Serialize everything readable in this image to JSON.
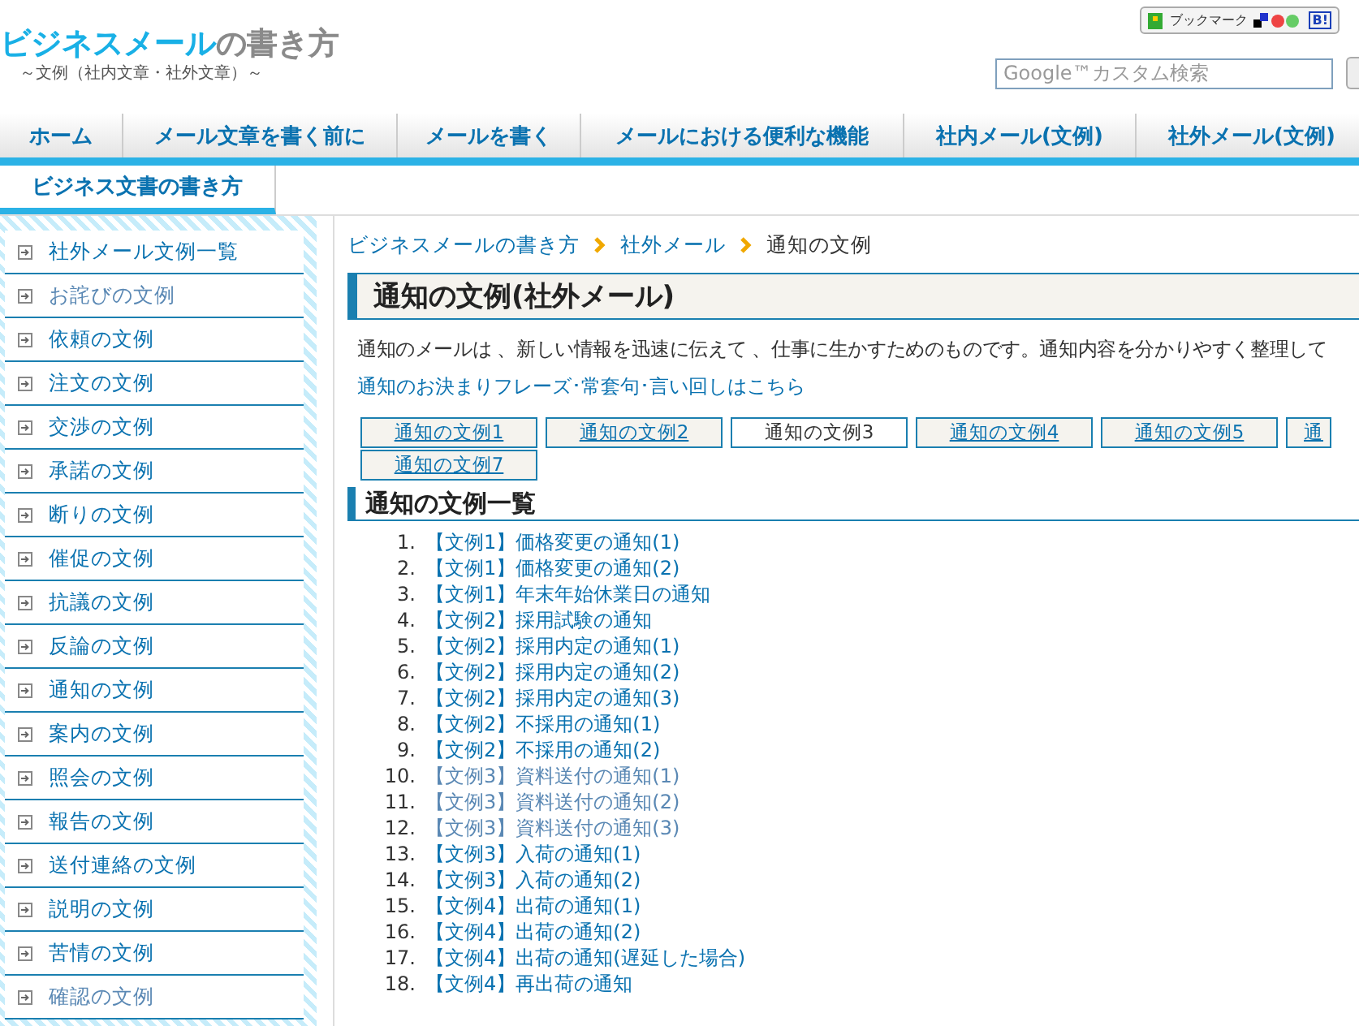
{
  "header": {
    "logo_main": "ビジネスメール",
    "logo_sub": "の書き方",
    "tagline": "～文例（社内文章・社外文章）～",
    "bookmark": {
      "label": "ブックマーク",
      "badge": "B!"
    },
    "search": {
      "placeholder": "Google™カスタム検索"
    }
  },
  "nav": [
    {
      "label": "ホーム"
    },
    {
      "label": "メール文章を書く前に"
    },
    {
      "label": "メールを書く"
    },
    {
      "label": "メールにおける便利な機能"
    },
    {
      "label": "社内メール(文例)"
    },
    {
      "label": "社外メール(文例)"
    }
  ],
  "subnav": {
    "label": "ビジネス文書の書き方"
  },
  "sidebar": {
    "items": [
      {
        "label": "社外メール文例一覧",
        "visited": false
      },
      {
        "label": "お詫びの文例",
        "visited": true
      },
      {
        "label": "依頼の文例",
        "visited": false
      },
      {
        "label": "注文の文例",
        "visited": false
      },
      {
        "label": "交渉の文例",
        "visited": false
      },
      {
        "label": "承諾の文例",
        "visited": false
      },
      {
        "label": "断りの文例",
        "visited": false
      },
      {
        "label": "催促の文例",
        "visited": false
      },
      {
        "label": "抗議の文例",
        "visited": false
      },
      {
        "label": "反論の文例",
        "visited": false
      },
      {
        "label": "通知の文例",
        "visited": false
      },
      {
        "label": "案内の文例",
        "visited": false
      },
      {
        "label": "照会の文例",
        "visited": false
      },
      {
        "label": "報告の文例",
        "visited": false
      },
      {
        "label": "送付連絡の文例",
        "visited": false
      },
      {
        "label": "説明の文例",
        "visited": false
      },
      {
        "label": "苦情の文例",
        "visited": false
      },
      {
        "label": "確認の文例",
        "visited": true
      }
    ]
  },
  "breadcrumb": [
    {
      "label": "ビジネスメールの書き方",
      "link": true
    },
    {
      "label": "社外メール",
      "link": true
    },
    {
      "label": "通知の文例",
      "link": false
    }
  ],
  "title": "通知の文例(社外メール)",
  "intro": "通知のメールは 、新しい情報を迅速に伝えて 、仕事に生かすためのものです。通知内容を分かりやすく整理して",
  "phrase_link": "通知のお決まりフレーズ･常套句･言い回しはこちら",
  "tabs": [
    {
      "label": "通知の文例1",
      "selected": false
    },
    {
      "label": "通知の文例2",
      "selected": false
    },
    {
      "label": "通知の文例3",
      "selected": true
    },
    {
      "label": "通知の文例4",
      "selected": false
    },
    {
      "label": "通知の文例5",
      "selected": false
    },
    {
      "label": "通",
      "selected": false
    },
    {
      "label": "通知の文例7",
      "selected": false
    }
  ],
  "list_title": "通知の文例一覧",
  "examples": [
    {
      "number": "1.",
      "label": "【文例1】価格変更の通知(1)",
      "visited": false
    },
    {
      "number": "2.",
      "label": "【文例1】価格変更の通知(2)",
      "visited": false
    },
    {
      "number": "3.",
      "label": "【文例1】年末年始休業日の通知",
      "visited": false
    },
    {
      "number": "4.",
      "label": "【文例2】採用試験の通知",
      "visited": false
    },
    {
      "number": "5.",
      "label": "【文例2】採用内定の通知(1)",
      "visited": false
    },
    {
      "number": "6.",
      "label": "【文例2】採用内定の通知(2)",
      "visited": false
    },
    {
      "number": "7.",
      "label": "【文例2】採用内定の通知(3)",
      "visited": false
    },
    {
      "number": "8.",
      "label": "【文例2】不採用の通知(1)",
      "visited": false
    },
    {
      "number": "9.",
      "label": "【文例2】不採用の通知(2)",
      "visited": false
    },
    {
      "number": "10.",
      "label": "【文例3】資料送付の通知(1)",
      "visited": true
    },
    {
      "number": "11.",
      "label": "【文例3】資料送付の通知(2)",
      "visited": true
    },
    {
      "number": "12.",
      "label": "【文例3】資料送付の通知(3)",
      "visited": true
    },
    {
      "number": "13.",
      "label": "【文例3】入荷の通知(1)",
      "visited": false
    },
    {
      "number": "14.",
      "label": "【文例3】入荷の通知(2)",
      "visited": false
    },
    {
      "number": "15.",
      "label": "【文例4】出荷の通知(1)",
      "visited": false
    },
    {
      "number": "16.",
      "label": "【文例4】出荷の通知(2)",
      "visited": false
    },
    {
      "number": "17.",
      "label": "【文例4】出荷の通知(遅延した場合)",
      "visited": false
    },
    {
      "number": "18.",
      "label": "【文例4】再出荷の通知",
      "visited": false
    }
  ]
}
